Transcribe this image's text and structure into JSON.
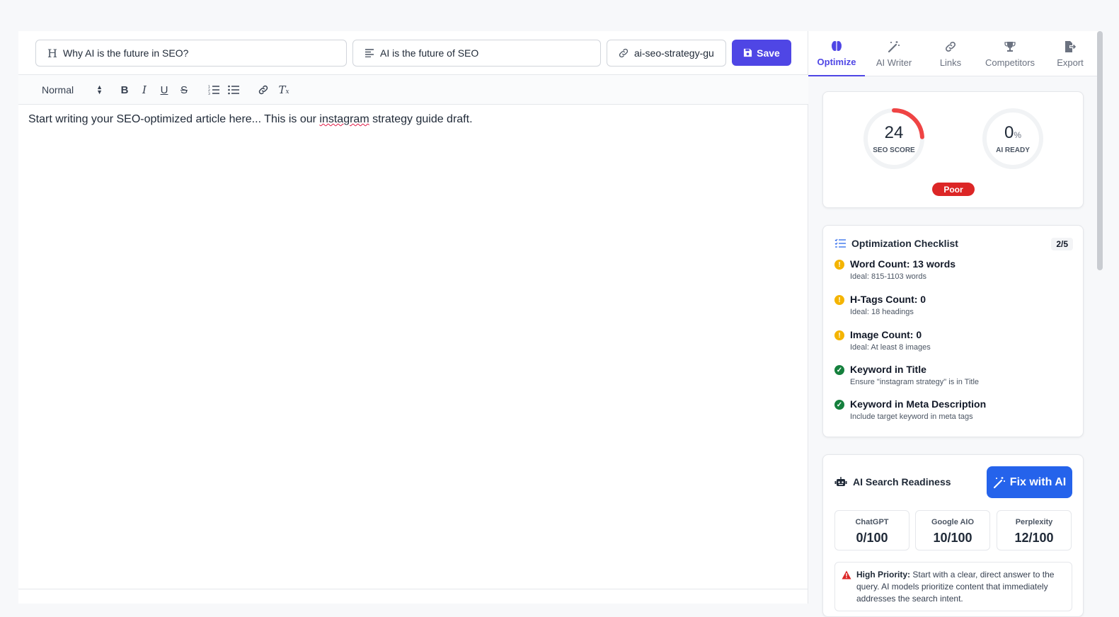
{
  "editor": {
    "title_value": "Why AI is the future in SEO?",
    "meta_value": "AI is the future of SEO",
    "slug_value": "ai-seo-strategy-gu",
    "save_label": "Save",
    "style_select": "Normal",
    "content_prefix": "Start writing your SEO-optimized article here... This is our ",
    "content_misspelled": "instagram",
    "content_suffix": " strategy guide draft."
  },
  "tabs": [
    {
      "label": "Optimize",
      "icon": "brain-icon"
    },
    {
      "label": "AI Writer",
      "icon": "magic-wand-icon"
    },
    {
      "label": "Links",
      "icon": "link-icon"
    },
    {
      "label": "Competitors",
      "icon": "trophy-icon"
    },
    {
      "label": "Export",
      "icon": "export-icon"
    }
  ],
  "score": {
    "seo_value": "24",
    "seo_label": "SEO SCORE",
    "seo_fraction": 0.24,
    "ai_value": "0",
    "ai_unit": "%",
    "ai_label": "AI READY",
    "badge": "Poor"
  },
  "checklist": {
    "title": "Optimization Checklist",
    "count": "2/5",
    "items": [
      {
        "title": "Word Count: 13 words",
        "sub": "Ideal: 815-1103 words",
        "status": "warning"
      },
      {
        "title": "H-Tags Count: 0",
        "sub": "Ideal: 18 headings",
        "status": "warning"
      },
      {
        "title": "Image Count: 0",
        "sub": "Ideal: At least 8 images",
        "status": "warning"
      },
      {
        "title": "Keyword in Title",
        "sub": "Ensure \"instagram strategy\" is in Title",
        "status": "ok"
      },
      {
        "title": "Keyword in Meta Description",
        "sub": "Include target keyword in meta tags",
        "status": "ok"
      }
    ]
  },
  "ai_readiness": {
    "title": "AI Search Readiness",
    "fix_label": "Fix with AI",
    "engines": [
      {
        "name": "ChatGPT",
        "value": "0/100"
      },
      {
        "name": "Google AIO",
        "value": "10/100"
      },
      {
        "name": "Perplexity",
        "value": "12/100"
      }
    ],
    "alert_label": "High Priority:",
    "alert_text": " Start with a clear, direct answer to the query. AI models prioritize content that immediately addresses the search intent."
  },
  "colors": {
    "accent": "#4f46e5",
    "score_red": "#ef4444",
    "warning": "#f4b400",
    "ok": "#15803d",
    "fix_blue": "#2563eb"
  }
}
